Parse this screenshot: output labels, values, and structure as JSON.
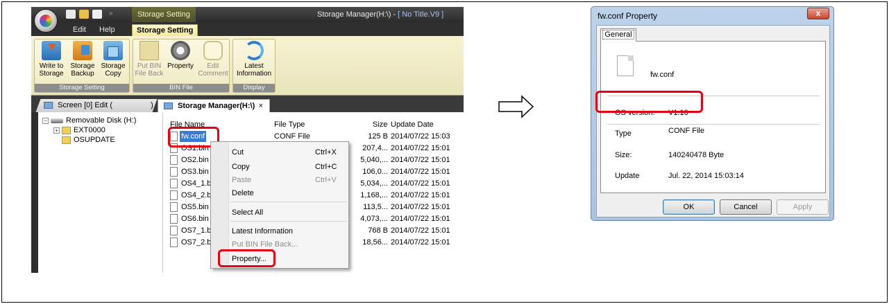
{
  "app": {
    "contextual_tab_title": "Storage Setting",
    "window_title": "Storage Manager(H:\\) - ",
    "window_document": "[ No Title.V9 ]",
    "ribbon_tabs": {
      "edit": "Edit",
      "help": "Help",
      "storage_setting": "Storage Setting"
    },
    "groups": {
      "storage_setting": {
        "caption": "Storage Setting",
        "buttons": [
          {
            "label_line1": "Write to",
            "label_line2": "Storage"
          },
          {
            "label_line1": "Storage",
            "label_line2": "Backup"
          },
          {
            "label_line1": "Storage",
            "label_line2": "Copy"
          }
        ]
      },
      "bin_file": {
        "caption": "BIN File",
        "buttons": [
          {
            "label_line1": "Put BIN",
            "label_line2": "File Back"
          },
          {
            "label_line1": "Property",
            "label_line2": ""
          },
          {
            "label_line1": "Edit",
            "label_line2": "Comment"
          }
        ]
      },
      "display": {
        "caption": "Display",
        "buttons": [
          {
            "label_line1": "Latest",
            "label_line2": "Information"
          }
        ]
      }
    },
    "doc_tabs": {
      "screen": "Screen [0] Edit (",
      "screen_close": ")",
      "storage": "Storage Manager(H:\\)",
      "close": "×"
    },
    "tree": {
      "root": "Removable Disk (H:)",
      "children": [
        "EXT0000",
        "OSUPDATE"
      ]
    },
    "file_list": {
      "headers": {
        "name": "File Name",
        "type": "File Type",
        "size": "Size",
        "date": "Update Date"
      },
      "rows": [
        {
          "name": "fw.conf",
          "type": "CONF File",
          "size": "125 B",
          "date": "2014/07/22 15:03"
        },
        {
          "name": "OS1.bin",
          "type": "",
          "size": "207,4...",
          "date": "2014/07/22 15:01"
        },
        {
          "name": "OS2.bin",
          "type": "",
          "size": "5,040,...",
          "date": "2014/07/22 15:01"
        },
        {
          "name": "OS3.bin",
          "type": "",
          "size": "106,0...",
          "date": "2014/07/22 15:01"
        },
        {
          "name": "OS4_1.bi",
          "type": "",
          "size": "5,034,...",
          "date": "2014/07/22 15:01"
        },
        {
          "name": "OS4_2.bi",
          "type": "",
          "size": "1,168,...",
          "date": "2014/07/22 15:01"
        },
        {
          "name": "OS5.bin",
          "type": "",
          "size": "113,5...",
          "date": "2014/07/22 15:01"
        },
        {
          "name": "OS6.bin",
          "type": "",
          "size": "4,073,...",
          "date": "2014/07/22 15:01"
        },
        {
          "name": "OS7_1.bi",
          "type": "",
          "size": "768 B",
          "date": "2014/07/22 15:01"
        },
        {
          "name": "OS7_2.bi",
          "type": "",
          "size": "18,56...",
          "date": "2014/07/22 15:01"
        }
      ]
    },
    "context_menu": {
      "cut": "Cut",
      "cut_shortcut": "Ctrl+X",
      "copy": "Copy",
      "copy_shortcut": "Ctrl+C",
      "paste": "Paste",
      "paste_shortcut": "Ctrl+V",
      "delete": "Delete",
      "select_all": "Select All",
      "latest_information": "Latest Information",
      "put_bin_file_back": "Put BIN File Back...",
      "property": "Property..."
    }
  },
  "dialog": {
    "title": "fw.conf Property",
    "close": "x",
    "tab": "General",
    "file_name": "fw.conf",
    "fields": {
      "os_version_label": "OS version:",
      "os_version_value": "V1.10",
      "type_label": "Type",
      "type_value": "CONF File",
      "size_label": "Size:",
      "size_value": "140240478 Byte",
      "update_label": "Update",
      "update_value": "Jul. 22, 2014 15:03:14"
    },
    "buttons": {
      "ok": "OK",
      "cancel": "Cancel",
      "apply": "Apply"
    }
  },
  "colors": {
    "highlight": "#e60012",
    "selection": "#3a7bd2",
    "ribbon": "#f3eec8"
  }
}
